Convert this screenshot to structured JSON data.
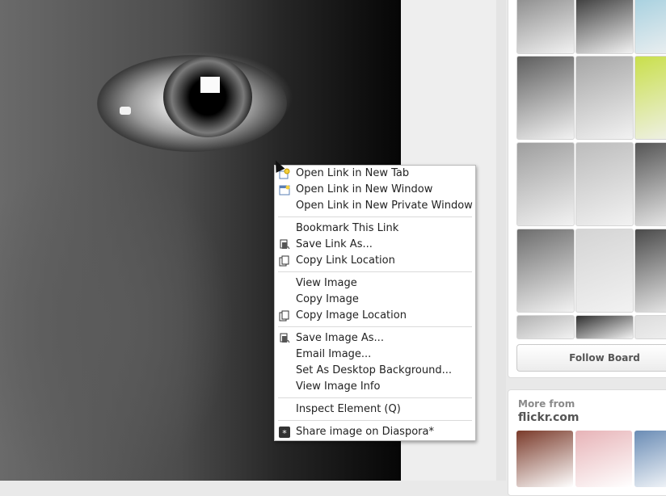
{
  "board": {
    "follow_label": "Follow Board",
    "thumb_colors": [
      "#8c8c8c",
      "#3a3a3a",
      "#a6d0df",
      "#5e5e5e",
      "#a5a5a5",
      "#c9df4b",
      "#9e9e9e",
      "#bcbcbc",
      "#555555",
      "#6d6d6d",
      "#d4d4d4",
      "#4a4a4a",
      "#b2b2b2",
      "#2f2f2f",
      "#dcdcdc"
    ]
  },
  "more_from": {
    "heading": "More from",
    "source": "flickr.com",
    "thumb_colors": [
      "#7a3a2a",
      "#e7b3b7",
      "#6a8cb5"
    ]
  },
  "context_menu": {
    "items": [
      {
        "label": "Open Link in New Tab",
        "icon": "new-tab-icon"
      },
      {
        "label": "Open Link in New Window",
        "icon": "new-window-icon"
      },
      {
        "label": "Open Link in New Private Window",
        "icon": ""
      },
      {
        "label": "Bookmark This Link",
        "icon": ""
      },
      {
        "label": "Save Link As...",
        "icon": "save-icon"
      },
      {
        "label": "Copy Link Location",
        "icon": "copy-icon"
      },
      {
        "label": "View Image",
        "icon": ""
      },
      {
        "label": "Copy Image",
        "icon": ""
      },
      {
        "label": "Copy Image Location",
        "icon": "copy-icon"
      },
      {
        "label": "Save Image As...",
        "icon": "save-icon"
      },
      {
        "label": "Email Image...",
        "icon": ""
      },
      {
        "label": "Set As Desktop Background...",
        "icon": ""
      },
      {
        "label": "View Image Info",
        "icon": ""
      },
      {
        "label": "Inspect Element (Q)",
        "icon": ""
      },
      {
        "label": "Share image on Diaspora*",
        "icon": "diaspora-icon"
      }
    ]
  }
}
